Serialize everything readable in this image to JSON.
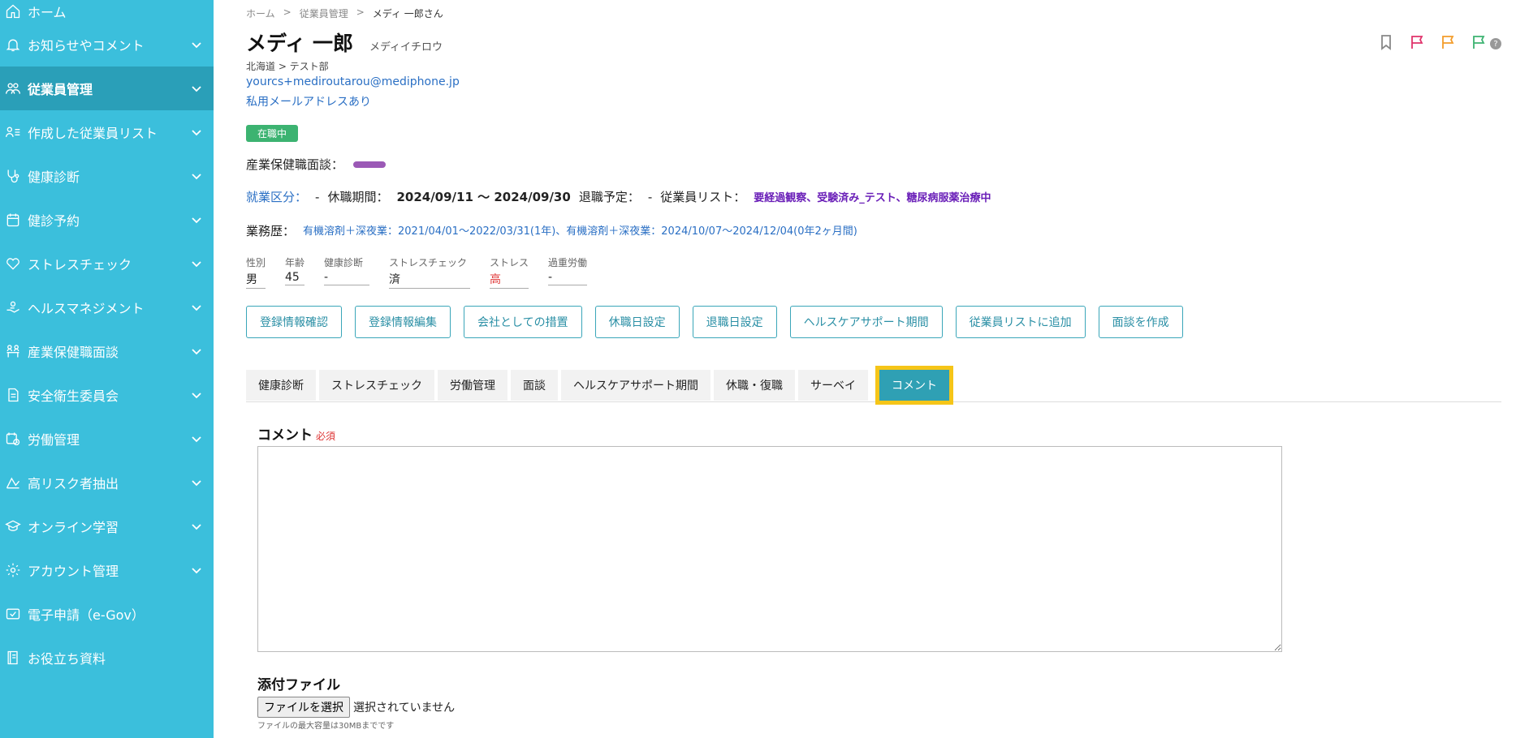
{
  "sidebar": {
    "items": [
      {
        "label": "ホーム",
        "icon": "home-icon"
      },
      {
        "label": "お知らせやコメント",
        "icon": "bell-icon"
      },
      {
        "label": "従業員管理",
        "icon": "users-icon"
      },
      {
        "label": "作成した従業員リスト",
        "icon": "user-list-icon"
      },
      {
        "label": "健康診断",
        "icon": "stethoscope-icon"
      },
      {
        "label": "健診予約",
        "icon": "calendar-icon"
      },
      {
        "label": "ストレスチェック",
        "icon": "heart-icon"
      },
      {
        "label": "ヘルスマネジメント",
        "icon": "hand-icon"
      },
      {
        "label": "産業保健職面談",
        "icon": "meeting-icon"
      },
      {
        "label": "安全衛生委員会",
        "icon": "document-icon"
      },
      {
        "label": "労働管理",
        "icon": "clock-calendar-icon"
      },
      {
        "label": "高リスク者抽出",
        "icon": "risk-icon"
      },
      {
        "label": "オンライン学習",
        "icon": "graduation-icon"
      },
      {
        "label": "アカウント管理",
        "icon": "gear-icon"
      },
      {
        "label": "電子申請（e-Gov）",
        "icon": "check-box-icon"
      },
      {
        "label": "お役立ち資料",
        "icon": "book-icon"
      }
    ]
  },
  "breadcrumb": {
    "home": "ホーム",
    "sep": ">",
    "section": "従業員管理",
    "current": "メディ 一郎さん"
  },
  "employee": {
    "name": "メディ 一郎",
    "kana": "メディイチロウ",
    "dept": "北海道 > テスト部",
    "email": "yourcs+mediroutarou@mediphone.jp",
    "private_email": "私用メールアドレスあり",
    "status": "在職中",
    "interview_label": "産業保健職面談："
  },
  "info": {
    "employment_label": "就業区分：",
    "employment_value": "-",
    "leave_label": "休職期間：",
    "leave_value": "2024/09/11 ～ 2024/09/30",
    "retire_label": "退職予定：",
    "retire_value": "-",
    "list_label": "従業員リスト：",
    "list_value": "要経過観察、受験済み_テスト、糖尿病服薬治療中"
  },
  "history": {
    "label": "業務歴：",
    "value": "有機溶剤＋深夜業：2021/04/01～2022/03/31(1年)、有機溶剤＋深夜業：2024/10/07～2024/12/04(0年2ヶ月間)"
  },
  "stats": [
    {
      "label": "性別",
      "value": "男"
    },
    {
      "label": "年齢",
      "value": "45"
    },
    {
      "label": "健康診断",
      "value": "-"
    },
    {
      "label": "ストレスチェック",
      "value": "済"
    },
    {
      "label": "ストレス",
      "value": "高"
    },
    {
      "label": "過重労働",
      "value": "-"
    }
  ],
  "actions": [
    "登録情報確認",
    "登録情報編集",
    "会社としての措置",
    "休職日設定",
    "退職日設定",
    "ヘルスケアサポート期間",
    "従業員リストに追加",
    "面談を作成"
  ],
  "tabs": [
    "健康診断",
    "ストレスチェック",
    "労働管理",
    "面談",
    "ヘルスケアサポート期間",
    "休職・復職",
    "サーベイ",
    "コメント"
  ],
  "comment": {
    "label": "コメント",
    "required": "必須",
    "value": ""
  },
  "attachment": {
    "label": "添付ファイル",
    "button": "ファイルを選択",
    "status": "選択されていません",
    "note": "ファイルの最大容量は30MBまでです"
  },
  "help": {
    "label": "?"
  },
  "colors": {
    "sidebar": "#3bbfdc",
    "sidebar_active": "#2a9fb8",
    "accent": "#2fa0b4",
    "highlight": "#f5c518",
    "flag_pink": "#e0336b",
    "flag_orange": "#f39c2a",
    "flag_green": "#3cb371"
  }
}
